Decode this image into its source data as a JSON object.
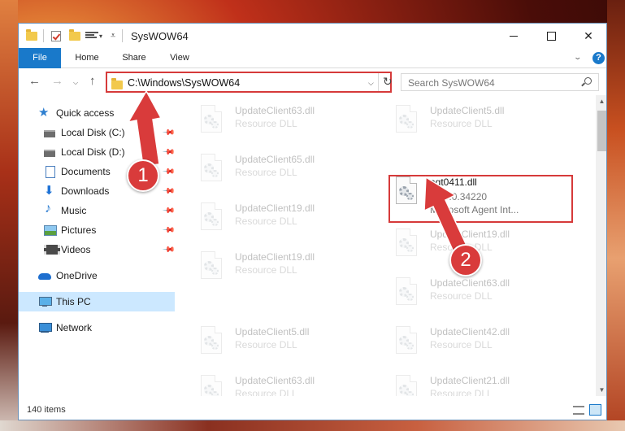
{
  "window": {
    "title": "SysWOW64",
    "controls": {
      "minimize": "",
      "maximize": "",
      "close": "✕"
    }
  },
  "ribbon": {
    "tabs": [
      "File",
      "Home",
      "Share",
      "View"
    ],
    "collapse_glyph": "⌄",
    "help_glyph": "?"
  },
  "address": {
    "path": "C:\\Windows\\SysWOW64",
    "dropdown_glyph": "⌵",
    "refresh_glyph": "↻"
  },
  "search": {
    "placeholder": "Search SysWOW64"
  },
  "nav": {
    "back": "←",
    "forward": "→",
    "recent": "⌵",
    "up": "↑",
    "items": [
      {
        "label": "Quick access",
        "icon": "star-icon"
      },
      {
        "label": "Local Disk (C:)",
        "icon": "disk-icon"
      },
      {
        "label": "Local Disk (D:)",
        "icon": "disk-icon"
      },
      {
        "label": "Documents",
        "icon": "document-icon"
      },
      {
        "label": "Downloads",
        "icon": "download-icon"
      },
      {
        "label": "Music",
        "icon": "music-icon"
      },
      {
        "label": "Pictures",
        "icon": "picture-icon"
      },
      {
        "label": "Videos",
        "icon": "video-icon"
      },
      {
        "label": "OneDrive",
        "icon": "cloud-icon"
      },
      {
        "label": "This PC",
        "icon": "computer-icon"
      },
      {
        "label": "Network",
        "icon": "network-icon"
      }
    ],
    "pin_glyph": "📌"
  },
  "files": [
    {
      "name": "UpdateClient63.dll",
      "type": "Resource DLL"
    },
    {
      "name": "UpdateClient5.dll",
      "type": "Resource DLL"
    },
    {
      "name": "UpdateClient65.dll",
      "type": "Resource DLL"
    },
    {
      "name": "agt0411.dll",
      "version": "2.00.0.34220",
      "description": "Microsoft Agent Int..."
    },
    {
      "name": "UpdateClient19.dll",
      "type": "Resource DLL"
    },
    {
      "name": "UpdateClient19.dll",
      "type": "Resource DLL"
    },
    {
      "name": "UpdateClient19.dll",
      "type": "Resource DLL"
    },
    {
      "name": "UpdateClient63.dll",
      "type": "Resource DLL"
    },
    {
      "name": "UpdateClient5.dll",
      "type": "Resource DLL"
    },
    {
      "name": "UpdateClient42.dll",
      "type": "Resource DLL"
    },
    {
      "name": "UpdateClient63.dll",
      "type": "Resource DLL"
    },
    {
      "name": "UpdateClient21.dll",
      "type": "Resource DLL"
    }
  ],
  "scrollbar": {
    "up": "▲",
    "down": "▼"
  },
  "status": {
    "item_count": "140 items"
  },
  "annotations": {
    "step1": "1",
    "step2": "2"
  }
}
